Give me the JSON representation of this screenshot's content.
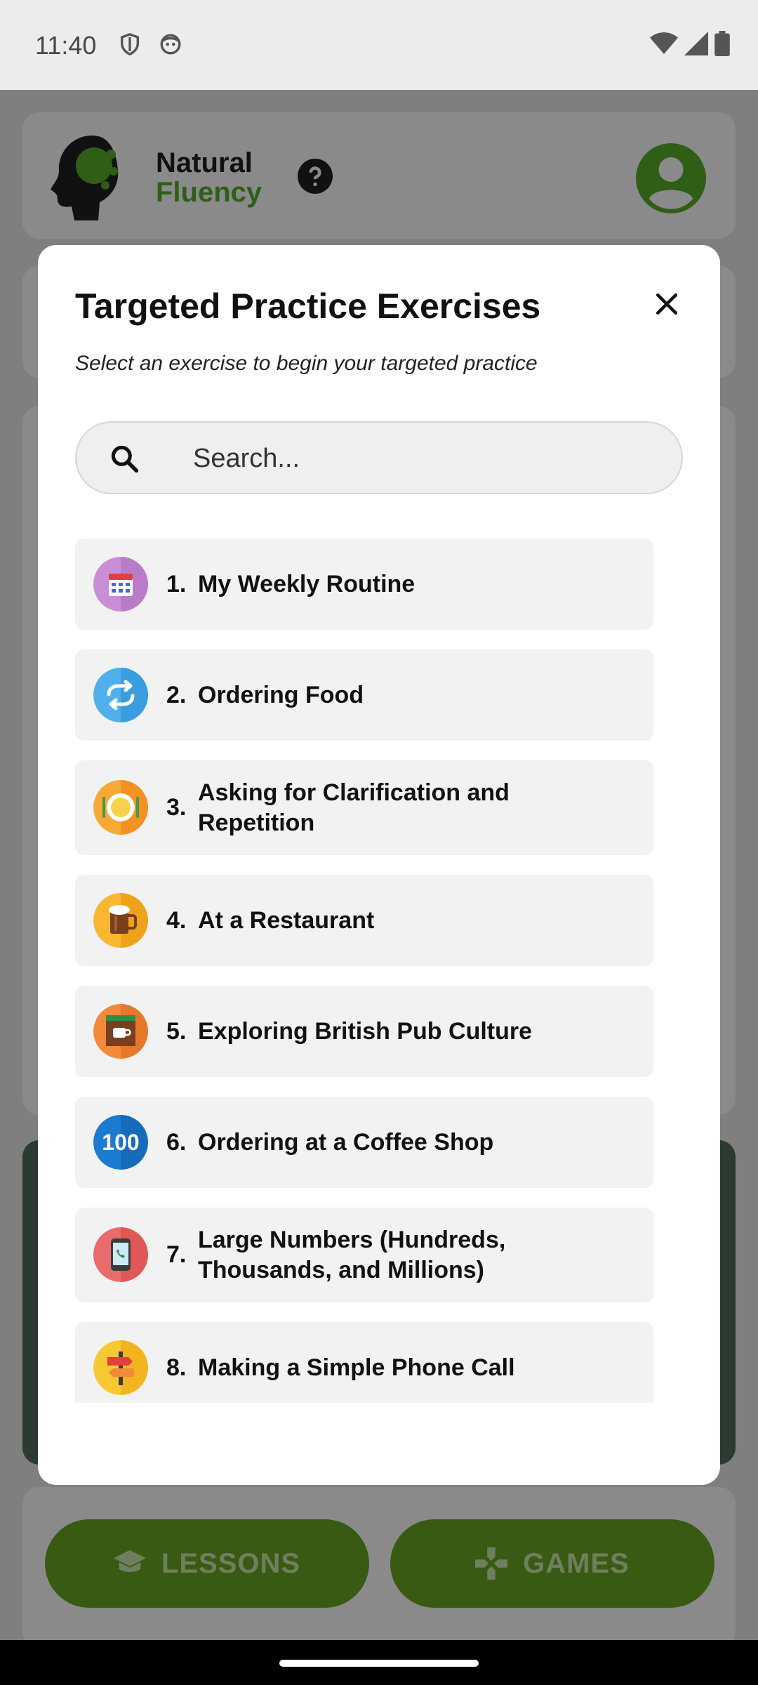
{
  "status_bar": {
    "time": "11:40"
  },
  "app": {
    "logo_line1": "Natural",
    "logo_line2": "Fluency",
    "nav_lessons": "LESSONS",
    "nav_games": "GAMES"
  },
  "modal": {
    "title": "Targeted Practice Exercises",
    "subtitle": "Select an exercise to begin your targeted practice",
    "search_placeholder": "Search...",
    "items": [
      {
        "num": "1.",
        "label": "My Weekly Routine",
        "icon": "calendar-icon"
      },
      {
        "num": "2.",
        "label": "Ordering Food",
        "icon": "repeat-icon"
      },
      {
        "num": "3.",
        "label": "Asking for Clarification and Repetition",
        "icon": "plate-icon"
      },
      {
        "num": "4.",
        "label": "At a Restaurant",
        "icon": "beer-mug-icon"
      },
      {
        "num": "5.",
        "label": "Exploring British Pub Culture",
        "icon": "coffee-shop-icon"
      },
      {
        "num": "6.",
        "label": "Ordering at a Coffee Shop",
        "icon": "hundred-icon"
      },
      {
        "num": "7.",
        "label": "Large Numbers (Hundreds, Thousands, and Millions)",
        "icon": "phone-call-icon"
      },
      {
        "num": "8.",
        "label": "Making a Simple Phone Call",
        "icon": "signpost-icon"
      }
    ]
  },
  "colors": {
    "brand_green": "#5aa82a",
    "button_green": "#385a12"
  }
}
